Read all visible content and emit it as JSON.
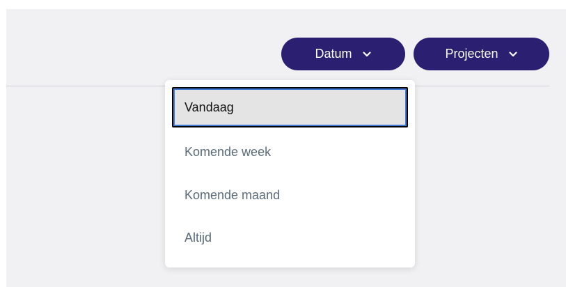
{
  "filters": {
    "datum_label": "Datum",
    "projecten_label": "Projecten",
    "chevron_icon": "chevron-down-icon"
  },
  "dropdown": {
    "options": [
      {
        "label": "Vandaag",
        "selected": true
      },
      {
        "label": "Komende week",
        "selected": false
      },
      {
        "label": "Komende maand",
        "selected": false
      },
      {
        "label": "Altijd",
        "selected": false
      }
    ]
  },
  "colors": {
    "button_bg": "#2a1f70",
    "button_text": "#ffffff",
    "option_text": "#5b6b7a",
    "selected_bg": "#e4e4e4",
    "focus_ring": "#3f7bd6",
    "panel_bg": "#f1f1f3"
  }
}
